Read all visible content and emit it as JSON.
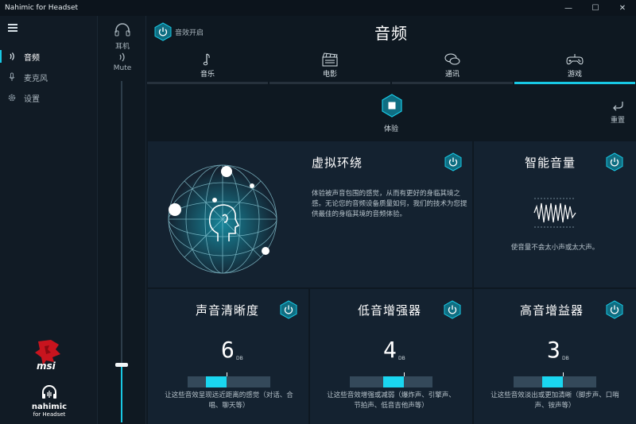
{
  "window": {
    "title": "Nahimic for Headset",
    "minimize": "—",
    "maximize": "☐",
    "close": "✕"
  },
  "sidebar": {
    "items": [
      {
        "label": "音频",
        "icon": "speaker-waves-icon"
      },
      {
        "label": "麦克风",
        "icon": "microphone-icon"
      },
      {
        "label": "设置",
        "icon": "gear-icon"
      }
    ],
    "msi_text": "msi",
    "nahimic_text": "nahimic",
    "nahimic_sub": "for Headset"
  },
  "device": {
    "headphone_label": "耳机",
    "mute_label": "Mute",
    "volume_level": 0.17
  },
  "header": {
    "effect_toggle_label": "音效开启",
    "title": "音频"
  },
  "tabs": [
    {
      "label": "音乐",
      "icon": "music-note-icon",
      "active": false
    },
    {
      "label": "电影",
      "icon": "clapperboard-icon",
      "active": false
    },
    {
      "label": "通讯",
      "icon": "chat-bubbles-icon",
      "active": false
    },
    {
      "label": "游戏",
      "icon": "gamepad-icon",
      "active": true
    }
  ],
  "experience": {
    "label": "体验",
    "reset_label": "重置"
  },
  "panels": {
    "virtual_surround": {
      "title": "虚拟环绕",
      "desc": "体验被声音包围的感觉，从而有更好的身临其境之感。无论您的音频设备质量如何，我们的技术为您提供最佳的身临其境的音频体验。"
    },
    "smart_volume": {
      "title": "智能音量",
      "desc": "使音量不会太小声或太大声。"
    },
    "voice_clarity": {
      "title": "声音清晰度",
      "value": "6",
      "unit": "DB",
      "level": 0.47,
      "desc": "让这些音效呈现远近距离的感觉（对话、合唱、聊天等）"
    },
    "bass_boost": {
      "title": "低音增强器",
      "value": "4",
      "unit": "DB",
      "level": 0.65,
      "desc": "让这些音效增强或减弱（爆炸声、引擎声、节拍声、低音吉他声等）"
    },
    "treble_boost": {
      "title": "高音增益器",
      "value": "3",
      "unit": "DB",
      "level": 0.6,
      "desc": "让这些音效淡出或更加清晰（脚步声、口哨声、铵声等）"
    }
  },
  "colors": {
    "accent": "#18c8e4",
    "bg": "#0e1821",
    "panel": "#142230"
  }
}
